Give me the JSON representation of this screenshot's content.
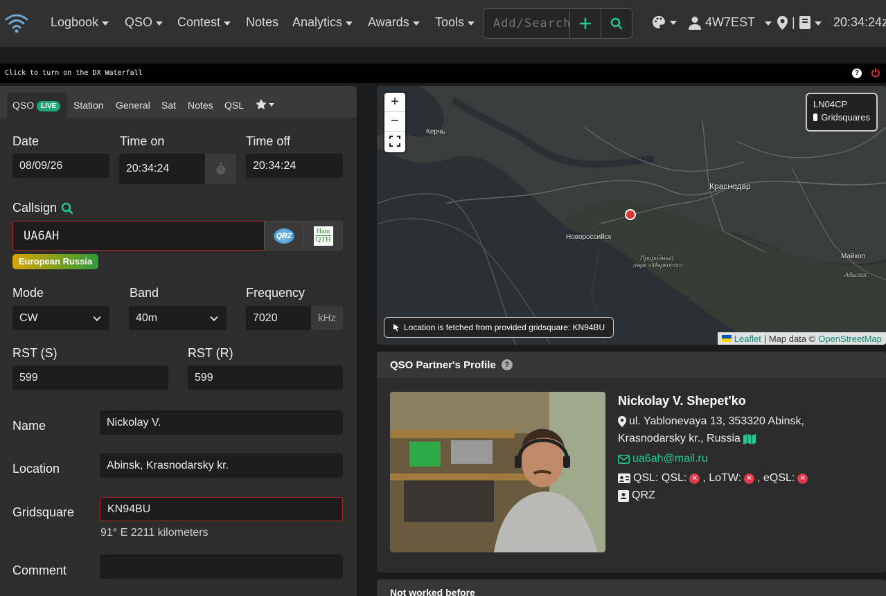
{
  "navbar": {
    "menu": [
      {
        "label": "Logbook",
        "dropdown": true
      },
      {
        "label": "QSO",
        "dropdown": true
      },
      {
        "label": "Contest",
        "dropdown": true
      },
      {
        "label": "Notes",
        "dropdown": false
      },
      {
        "label": "Analytics",
        "dropdown": true
      },
      {
        "label": "Awards",
        "dropdown": true
      },
      {
        "label": "Tools",
        "dropdown": true
      }
    ],
    "search_placeholder": "Add/Search",
    "user": "4W7EST",
    "clock": "20:34:24z",
    "icons": [
      "wifi-logo-icon",
      "plus-icon",
      "search-icon",
      "palette-icon",
      "user-icon",
      "location-pin-icon",
      "book-icon"
    ]
  },
  "dx_waterfall": {
    "text": "Click to turn on the DX Waterfall",
    "help": "?"
  },
  "qso_tabs": {
    "active": "QSO",
    "live_badge": "LIVE",
    "others": [
      "Station",
      "General",
      "Sat",
      "Notes",
      "QSL"
    ]
  },
  "form": {
    "date_label": "Date",
    "date_value": "08/09/26",
    "time_on_label": "Time on",
    "time_on_value": "20:34:24",
    "time_off_label": "Time off",
    "time_off_value": "20:34:24",
    "callsign_label": "Callsign",
    "callsign_value": "UA6AH",
    "dxcc_badge": "European Russia",
    "qrz_logo": "QRZ",
    "hamqth_logo_top": "Ham",
    "hamqth_logo_bottom": "QTH",
    "mode_label": "Mode",
    "mode_value": "CW",
    "band_label": "Band",
    "band_value": "40m",
    "frequency_label": "Frequency",
    "frequency_value": "7020",
    "frequency_unit": "kHz",
    "rst_s_label": "RST (S)",
    "rst_s_value": "599",
    "rst_r_label": "RST (R)",
    "rst_r_value": "599",
    "name_label": "Name",
    "name_value": "Nickolay V.",
    "location_label": "Location",
    "location_value": "Abinsk, Krasnodarsky kr.",
    "gridsquare_label": "Gridsquare",
    "gridsquare_value": "KN94BU",
    "bearing_text": "91° E 2211 kilometers",
    "comment_label": "Comment",
    "comment_value": ""
  },
  "map": {
    "zoom_in": "+",
    "zoom_out": "−",
    "layer_title": "LN04CP",
    "layer_option": "Gridsquares",
    "note": "Location is fetched from provided gridsquare: KN94BU",
    "labels": {
      "kerch": "Керчь",
      "krasnodar": "Краснодар",
      "novorossiysk": "Новороссийск",
      "maykop": "Майкоп",
      "adygeya": "Адыгея",
      "park_line1": "Природный",
      "park_line2": "парк «Маркотх»"
    },
    "attribution": {
      "leaflet": "Leaflet",
      "separator": "| Map data ©",
      "osm": "OpenStreetMap"
    }
  },
  "profile": {
    "header": "QSO Partner's Profile",
    "name": "Nickolay V. Shepet'ko",
    "address_line1": "ul. Yablonevaya 13, 353320 Abinsk,",
    "address_line2": "Krasnodarsky kr., Russia",
    "email": "ua6ah@mail.ru",
    "qsl_label": "QSL: QSL:",
    "lotw_label": ", LoTW:",
    "eqsl_label": ", eQSL:",
    "source": "QRZ"
  },
  "worked_before": {
    "header": "Not worked before"
  },
  "colors": {
    "accent_green": "#20c997",
    "error_red": "#e0394a",
    "badge_live": "#20a777"
  }
}
